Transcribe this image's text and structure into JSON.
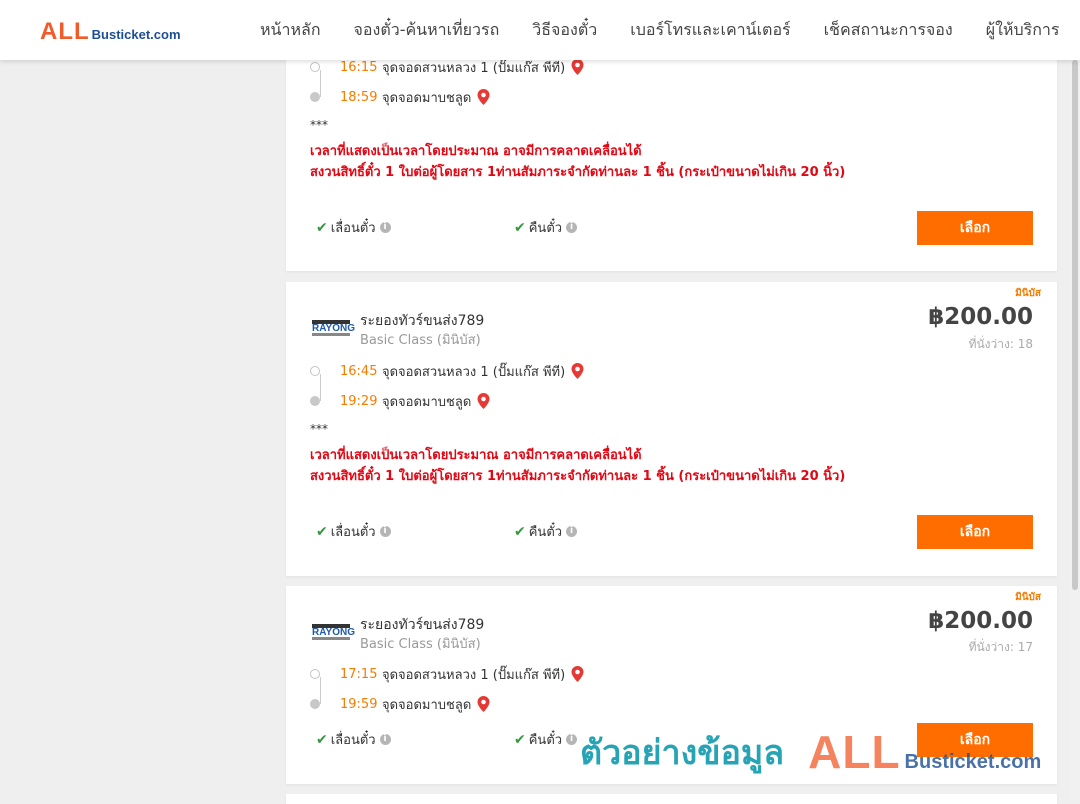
{
  "header": {
    "logo": {
      "all": "ALL",
      "rest": "Busticket.com"
    },
    "nav": [
      "หน้าหลัก",
      "จองตั๋ว-ค้นหาเที่ยวรถ",
      "วิธีจองตั๋ว",
      "เบอร์โทรและเคาน์เตอร์",
      "เช็คสถานะการจอง",
      "ผู้ให้บริการ"
    ]
  },
  "trips": [
    {
      "badge": "",
      "operator": "",
      "class": "",
      "price": "",
      "seats": "",
      "depart": {
        "time": "16:15",
        "place": "จุดจอดสวนหลวง 1 (ปั๊มแก๊ส พีที)"
      },
      "arrive": {
        "time": "18:59",
        "place": "จุดจอดมาบชลูด"
      },
      "note_stars": "***",
      "note_line1": "เวลาที่แสดงเป็นเวลาโดยประมาณ อาจมีการคลาดเคลื่อนได้",
      "note_line2": "สงวนสิทธิ์ตั๋ว 1 ใบต่อผู้โดยสาร 1ท่านสัมภาระจำกัดท่านละ 1 ชิ้น (กระเป๋าขนาดไม่เกิน 20 นิ้ว)",
      "reschedule": "เลื่อนตั๋ว",
      "refund": "คืนตั๋ว",
      "select": "เลือก"
    },
    {
      "badge": "มินิบัส",
      "logo_text": "RAYONG",
      "operator": "ระยองทัวร์ขนส่ง789",
      "class": "Basic Class (มินิบัส)",
      "price": "฿200.00",
      "seats": "ที่นั่งว่าง: 18",
      "depart": {
        "time": "16:45",
        "place": "จุดจอดสวนหลวง 1 (ปั๊มแก๊ส พีที)"
      },
      "arrive": {
        "time": "19:29",
        "place": "จุดจอดมาบชลูด"
      },
      "note_stars": "***",
      "note_line1": "เวลาที่แสดงเป็นเวลาโดยประมาณ อาจมีการคลาดเคลื่อนได้",
      "note_line2": "สงวนสิทธิ์ตั๋ว 1 ใบต่อผู้โดยสาร 1ท่านสัมภาระจำกัดท่านละ 1 ชิ้น (กระเป๋าขนาดไม่เกิน 20 นิ้ว)",
      "reschedule": "เลื่อนตั๋ว",
      "refund": "คืนตั๋ว",
      "select": "เลือก"
    },
    {
      "badge": "มินิบัส",
      "logo_text": "RAYONG",
      "operator": "ระยองทัวร์ขนส่ง789",
      "class": "Basic Class (มินิบัส)",
      "price": "฿200.00",
      "seats": "ที่นั่งว่าง: 17",
      "depart": {
        "time": "17:15",
        "place": "จุดจอดสวนหลวง 1 (ปั๊มแก๊ส พีที)"
      },
      "arrive": {
        "time": "19:59",
        "place": "จุดจอดมาบชลูด"
      },
      "reschedule": "เลื่อนตั๋ว",
      "refund": "คืนตั๋ว",
      "select": "เลือก"
    }
  ],
  "watermark": {
    "text": "ตัวอย่างข้อมูล",
    "all": "ALL",
    "rest": "Busticket.com"
  },
  "colors": {
    "accent": "#ff6d00",
    "time": "#f57c00",
    "warning": "#e30613",
    "check": "#2e9b3a",
    "pin": "#e53935"
  }
}
